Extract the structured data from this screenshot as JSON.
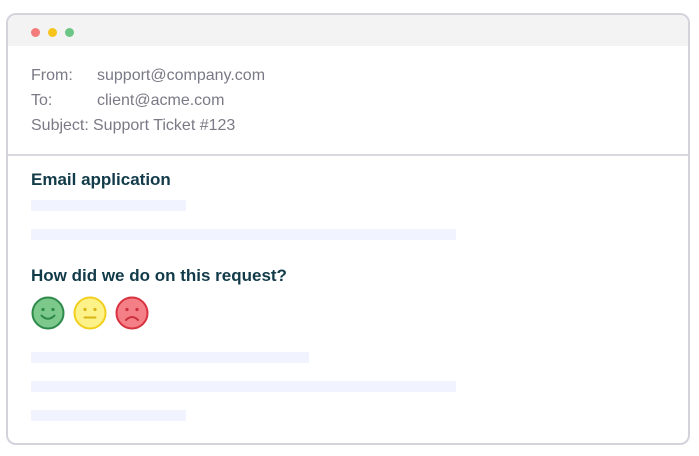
{
  "window": {
    "controls": [
      "close",
      "minimize",
      "maximize"
    ],
    "colors": {
      "close": "#f47c7c",
      "minimize": "#f6c41b",
      "maximize": "#6cc685"
    }
  },
  "email": {
    "from_label": "From:",
    "from_value": "support@company.com",
    "to_label": "To:",
    "to_value": "client@acme.com",
    "subject_label": "Subject:",
    "subject_value": "Support Ticket #123"
  },
  "body": {
    "heading": "Email application",
    "question": "How did we do on this request?",
    "ratings": [
      {
        "name": "happy-face-icon",
        "color": "#7cc98b"
      },
      {
        "name": "neutral-face-icon",
        "color": "#fdf18a"
      },
      {
        "name": "sad-face-icon",
        "color": "#f47f87"
      }
    ]
  }
}
